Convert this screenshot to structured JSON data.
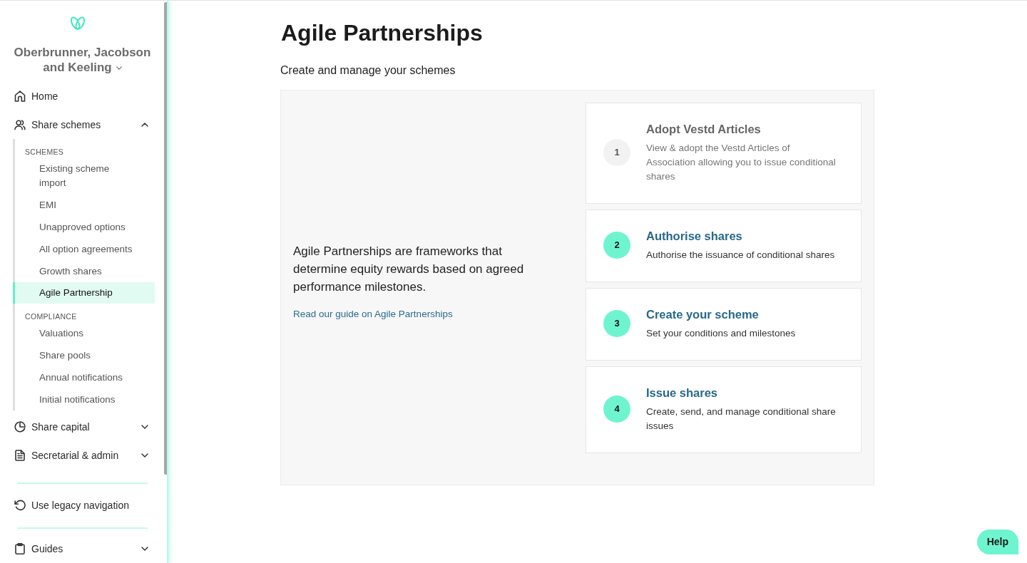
{
  "sidebar": {
    "company": "Oberbrunner, Jacobson and Keeling",
    "nav": [
      {
        "kind": "link",
        "label": "Home"
      },
      {
        "kind": "section",
        "label": "Share schemes",
        "expanded": true,
        "groups": [
          {
            "heading": "SCHEMES",
            "items": [
              {
                "label": "Existing scheme import",
                "selected": false
              },
              {
                "label": "EMI",
                "selected": false
              },
              {
                "label": "Unapproved options",
                "selected": false
              },
              {
                "label": "All option agreements",
                "selected": false
              },
              {
                "label": "Growth shares",
                "selected": false
              },
              {
                "label": "Agile Partnership",
                "selected": true
              }
            ]
          },
          {
            "heading": "COMPLIANCE",
            "items": [
              {
                "label": "Valuations",
                "selected": false
              },
              {
                "label": "Share pools",
                "selected": false
              },
              {
                "label": "Annual notifications",
                "selected": false
              },
              {
                "label": "Initial notifications",
                "selected": false
              }
            ]
          }
        ]
      },
      {
        "kind": "section",
        "label": "Share capital",
        "expanded": false
      },
      {
        "kind": "section",
        "label": "Secretarial & admin",
        "expanded": false
      }
    ],
    "footer": [
      {
        "kind": "link",
        "label": "Use legacy navigation"
      },
      {
        "kind": "section",
        "label": "Guides",
        "expanded": false
      }
    ]
  },
  "main": {
    "title": "Agile Partnerships",
    "subtitle": "Create and manage your schemes",
    "intro": {
      "text": "Agile Partnerships are frameworks that determine equity rewards based on agreed performance milestones.",
      "link": "Read our guide on Agile Partnerships"
    },
    "steps": [
      {
        "number": "1",
        "title": "Adopt Vestd Articles",
        "description": "View & adopt the Vestd Articles of Association allowing you to issue conditional shares",
        "disabled": true
      },
      {
        "number": "2",
        "title": "Authorise shares",
        "description": "Authorise the issuance of conditional shares",
        "disabled": false
      },
      {
        "number": "3",
        "title": "Create your scheme",
        "description": "Set your conditions and milestones",
        "disabled": false
      },
      {
        "number": "4",
        "title": "Issue shares",
        "description": "Create, send, and manage conditional share issues",
        "disabled": false
      }
    ]
  },
  "help_button": "Help"
}
